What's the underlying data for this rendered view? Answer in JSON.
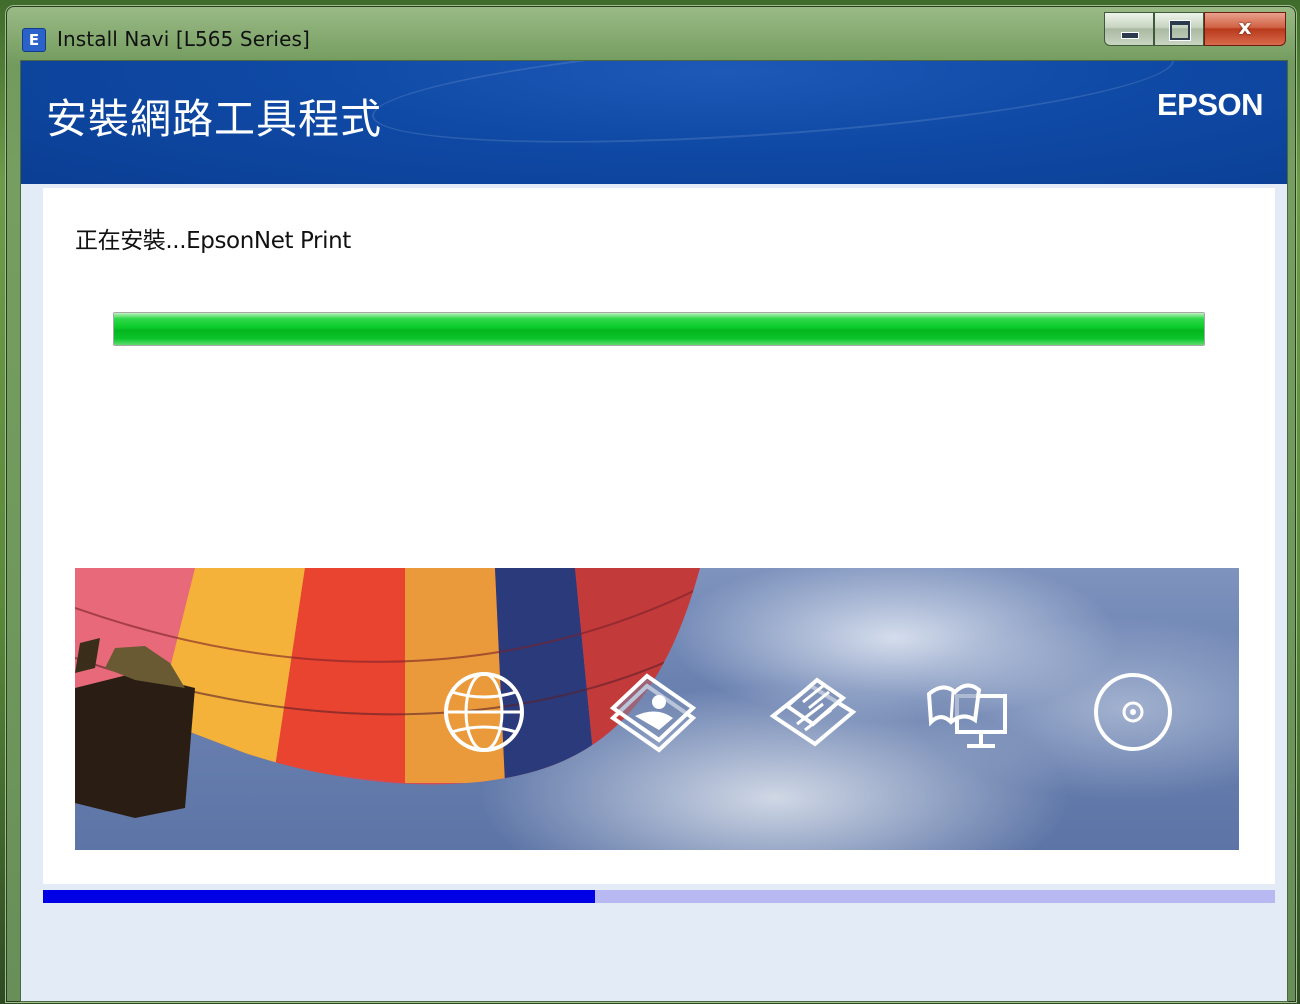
{
  "window": {
    "title": "Install Navi [L565 Series]",
    "app_icon_letter": "E",
    "close_glyph": "x"
  },
  "header": {
    "title": "安裝網路工具程式",
    "brand": "EPSON",
    "color": "#0f4aa6"
  },
  "main": {
    "status_text": "正在安裝...EpsonNet Print",
    "install_progress": 1.0,
    "progress_color": "#0bcc2a"
  },
  "banner": {
    "icons": [
      "globe-icon",
      "photo-print-icon",
      "documents-icon",
      "manual-monitor-icon",
      "disc-icon"
    ]
  },
  "step_progress": {
    "fraction": 0.448,
    "fill_color": "#0000e6",
    "track_color": "#b8b8f2"
  }
}
